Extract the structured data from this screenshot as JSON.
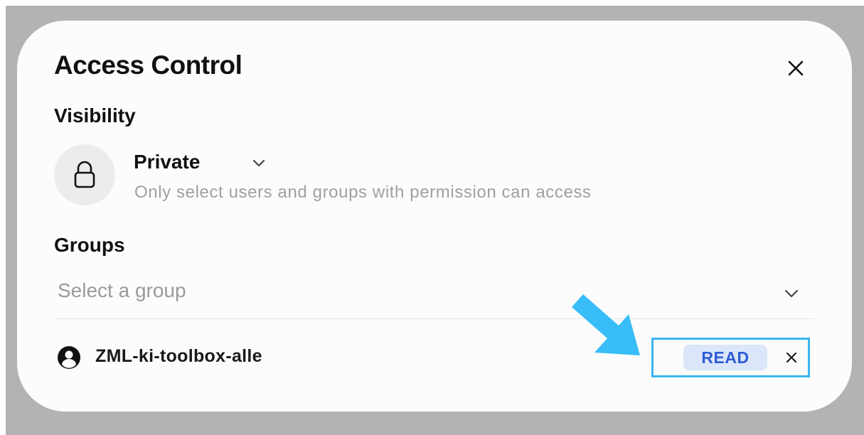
{
  "dialog": {
    "title": "Access Control",
    "close_icon": "close-icon"
  },
  "visibility": {
    "label": "Visibility",
    "icon": "lock-icon",
    "selected": "Private",
    "description": "Only select users and groups with permission can access"
  },
  "groups": {
    "label": "Groups",
    "placeholder": "Select a group",
    "items": [
      {
        "name": "ZML-ki-toolbox-alle",
        "icon": "user-circle-icon",
        "permission": "READ"
      }
    ]
  },
  "colors": {
    "highlight_border": "#38b6ee",
    "arrow": "#38bdf8",
    "badge_bg": "#dbe6fb",
    "badge_text": "#2f5bd6"
  }
}
